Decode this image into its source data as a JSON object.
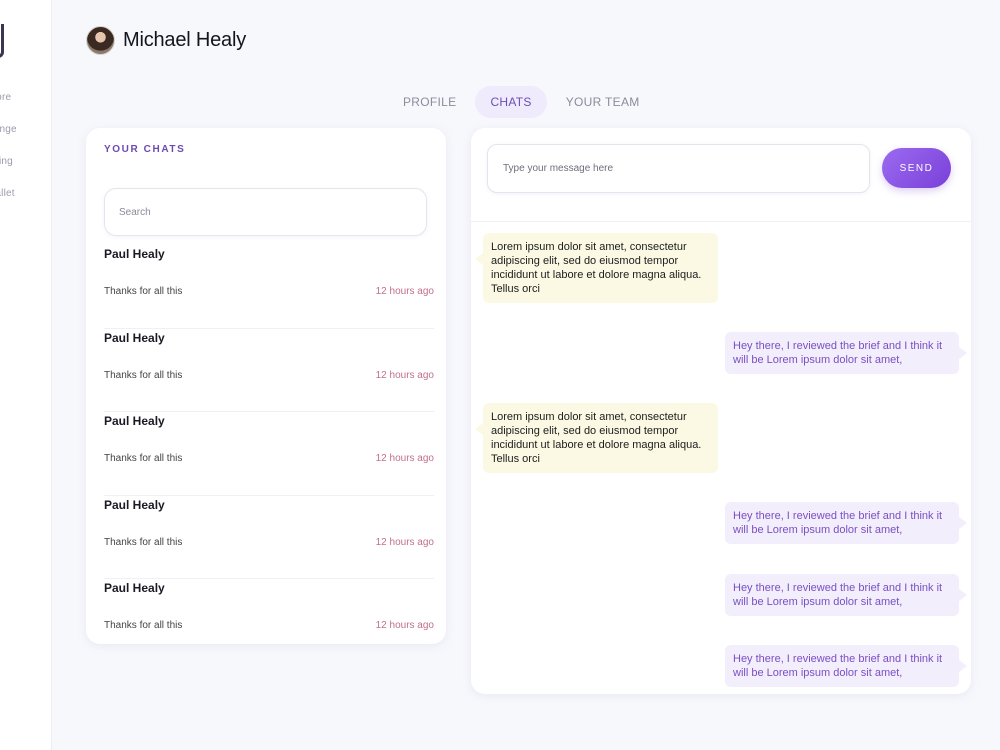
{
  "sidebar": {
    "items": [
      {
        "label": "plore"
      },
      {
        "label": "hange"
      },
      {
        "label": "aking"
      },
      {
        "label": " wallet"
      }
    ]
  },
  "header": {
    "name": "Michael Healy"
  },
  "tabs": [
    {
      "label": "PROFILE",
      "active": false
    },
    {
      "label": "CHATS",
      "active": true
    },
    {
      "label": "YOUR TEAM",
      "active": false
    }
  ],
  "chats": {
    "title": "YOUR CHATS",
    "search_placeholder": "Search",
    "items": [
      {
        "name": "Paul Healy",
        "preview": "Thanks for all this",
        "time": "12 hours ago"
      },
      {
        "name": "Paul Healy",
        "preview": "Thanks for all this",
        "time": "12 hours ago"
      },
      {
        "name": "Paul Healy",
        "preview": "Thanks for all this",
        "time": "12 hours ago"
      },
      {
        "name": "Paul Healy",
        "preview": "Thanks for all this",
        "time": "12 hours ago"
      },
      {
        "name": "Paul Healy",
        "preview": "Thanks for all this",
        "time": "12 hours ago"
      }
    ]
  },
  "conversation": {
    "input_placeholder": "Type your message here",
    "send_label": "SEND",
    "messages": [
      {
        "dir": "in",
        "text": "Lorem ipsum dolor sit amet, consectetur adipiscing elit, sed do eiusmod tempor incididunt ut labore et dolore magna aliqua. Tellus orci"
      },
      {
        "dir": "out",
        "text": "Hey there, I reviewed the brief and I think it will be Lorem ipsum dolor sit amet,"
      },
      {
        "dir": "in",
        "text": "Lorem ipsum dolor sit amet, consectetur adipiscing elit, sed do eiusmod tempor incididunt ut labore et dolore magna aliqua. Tellus orci"
      },
      {
        "dir": "out",
        "text": "Hey there, I reviewed the brief and I think it will be Lorem ipsum dolor sit amet,"
      },
      {
        "dir": "out",
        "text": "Hey there, I reviewed the brief and I think it will be Lorem ipsum dolor sit amet,"
      },
      {
        "dir": "out",
        "text": "Hey there, I reviewed the brief and I think it will be Lorem ipsum dolor sit amet,"
      }
    ]
  },
  "colors": {
    "accent": "#7a3fd8",
    "tab_active_bg": "#efeafc",
    "incoming_bubble": "#fbf9e3",
    "outgoing_bubble": "#f3eefc",
    "timestamp": "#c2708a"
  }
}
